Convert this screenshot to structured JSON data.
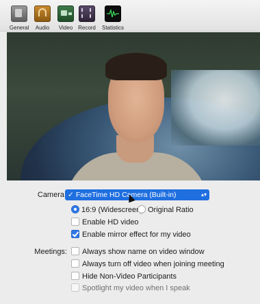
{
  "toolbar": {
    "items": [
      {
        "label": "General",
        "icon": "general-icon"
      },
      {
        "label": "Audio",
        "icon": "headphones-icon"
      },
      {
        "label": "Video",
        "icon": "video-camera-icon"
      },
      {
        "label": "Record",
        "icon": "film-reel-icon"
      },
      {
        "label": "Statistics",
        "icon": "waveform-icon"
      }
    ]
  },
  "camera": {
    "label": "Camera",
    "selected": "FaceTime HD Camera (Built-in)",
    "check": "✓"
  },
  "ratio": {
    "widescreen": "16:9 (Widescreen)",
    "original": "Original Ratio",
    "selected": "16:9 (Widescreen)"
  },
  "video_options": {
    "hd": {
      "label": "Enable HD video",
      "checked": false
    },
    "mirror": {
      "label": "Enable mirror effect for my video",
      "checked": true
    }
  },
  "meetings": {
    "label": "Meetings:",
    "options": [
      {
        "label": "Always show name on video window",
        "checked": false
      },
      {
        "label": "Always turn off video when joining meeting",
        "checked": false
      },
      {
        "label": "Hide Non-Video Participants",
        "checked": false
      },
      {
        "label": "Spotlight my video when I speak",
        "checked": false
      }
    ]
  },
  "colors": {
    "accent": "#2f78e6",
    "select_highlight": "#1f6fe0",
    "background": "#ececec"
  }
}
